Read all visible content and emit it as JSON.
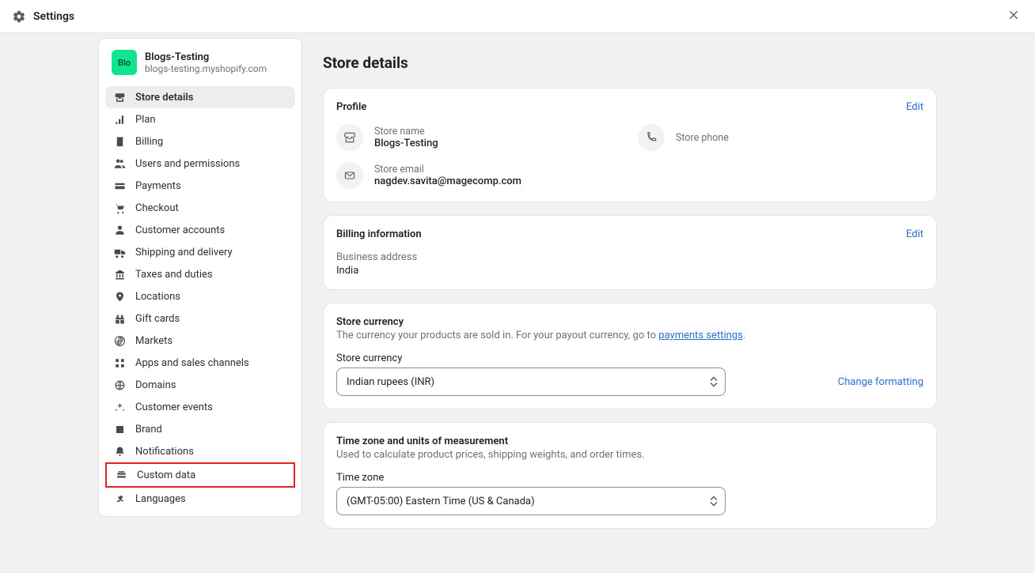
{
  "topbar": {
    "title": "Settings"
  },
  "store": {
    "avatar": "Blo",
    "name": "Blogs-Testing",
    "domain": "blogs-testing.myshopify.com"
  },
  "sidebar": {
    "items": [
      {
        "label": "Store details",
        "active": true
      },
      {
        "label": "Plan"
      },
      {
        "label": "Billing"
      },
      {
        "label": "Users and permissions"
      },
      {
        "label": "Payments"
      },
      {
        "label": "Checkout"
      },
      {
        "label": "Customer accounts"
      },
      {
        "label": "Shipping and delivery"
      },
      {
        "label": "Taxes and duties"
      },
      {
        "label": "Locations"
      },
      {
        "label": "Gift cards"
      },
      {
        "label": "Markets"
      },
      {
        "label": "Apps and sales channels"
      },
      {
        "label": "Domains"
      },
      {
        "label": "Customer events"
      },
      {
        "label": "Brand"
      },
      {
        "label": "Notifications"
      },
      {
        "label": "Custom data",
        "highlighted": true
      },
      {
        "label": "Languages"
      }
    ]
  },
  "main": {
    "title": "Store details",
    "profile": {
      "heading": "Profile",
      "edit": "Edit",
      "store_name_label": "Store name",
      "store_name_value": "Blogs-Testing",
      "store_phone_label": "Store phone",
      "store_email_label": "Store email",
      "store_email_value": "nagdev.savita@magecomp.com"
    },
    "billing": {
      "heading": "Billing information",
      "edit": "Edit",
      "address_label": "Business address",
      "address_value": "India"
    },
    "currency": {
      "heading": "Store currency",
      "description_pre": "The currency your products are sold in. For your payout currency, go to ",
      "description_link": "payments settings",
      "description_post": ".",
      "field_label": "Store currency",
      "selected": "Indian rupees (INR)",
      "change_formatting": "Change formatting"
    },
    "timezone": {
      "heading": "Time zone and units of measurement",
      "description": "Used to calculate product prices, shipping weights, and order times.",
      "field_label": "Time zone",
      "selected": "(GMT-05:00) Eastern Time (US & Canada)"
    }
  }
}
